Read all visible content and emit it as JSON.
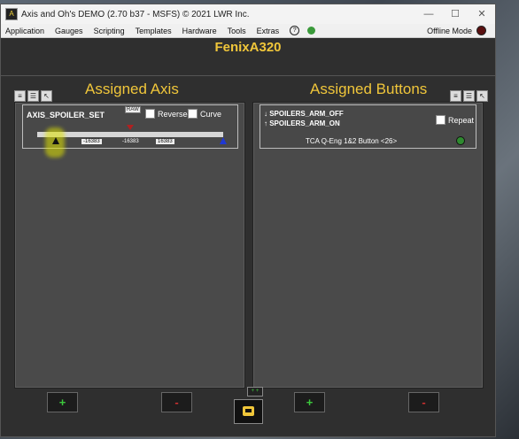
{
  "window": {
    "title": "Axis and Oh's DEMO (2.70 b37 - MSFS) © 2021 LWR Inc.",
    "minimize": "—",
    "maximize": "☐",
    "close": "✕"
  },
  "menu": {
    "items": [
      "Application",
      "Gauges",
      "Scripting",
      "Templates",
      "Hardware",
      "Tools",
      "Extras"
    ],
    "help": "?",
    "offline_label": "Offline Mode"
  },
  "profile": {
    "name": "FenixA320"
  },
  "assigned_axis": {
    "title": "Assigned Axis",
    "card": {
      "name": "AXIS_SPOILER_SET",
      "raw_label": "RAW",
      "reversed_label": "Reversed",
      "curve_label": "Curve",
      "min_value": "-16383",
      "current_value": "-16383",
      "max_value": "16383"
    }
  },
  "assigned_buttons": {
    "title": "Assigned Buttons",
    "card": {
      "line1": "↓ SPOILERS_ARM_OFF",
      "line2": "↑ SPOILERS_ARM_ON",
      "repeat_label": "Repeat",
      "device": "TCA Q-Eng 1&2 Button <26>"
    }
  },
  "bottom": {
    "plus": "+",
    "minus": "-",
    "mini": "+ +"
  },
  "colors": {
    "accent": "#f0c63a",
    "add": "#3cc83c",
    "remove": "#d03030",
    "led": "#2f8a30"
  }
}
